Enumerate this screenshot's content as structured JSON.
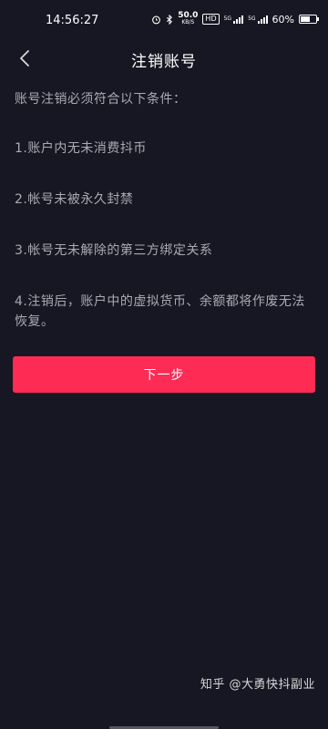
{
  "status_bar": {
    "time": "14:56:27",
    "net_speed": "50.0",
    "net_speed_unit": "KB/S",
    "hd_badge": "HD",
    "sig1_label": "5G",
    "sig2_label": "5G",
    "battery_percent": "60%",
    "battery_level": 0.6
  },
  "nav": {
    "title": "注销账号",
    "back_icon": "chevron-left-icon"
  },
  "content": {
    "intro": "账号注销必须符合以下条件：",
    "conditions": [
      "1.账户内无未消费抖币",
      "2.帐号未被永久封禁",
      "3.帐号无未解除的第三方绑定关系",
      "4.注销后，账户中的虚拟货币、余额都将作废无法恢复。"
    ]
  },
  "actions": {
    "next_label": "下一步"
  },
  "watermark": {
    "text": "知乎 @大勇快抖副业"
  },
  "colors": {
    "background": "#161722",
    "accent": "#fe2c55",
    "text_muted": "#a9aab2"
  }
}
